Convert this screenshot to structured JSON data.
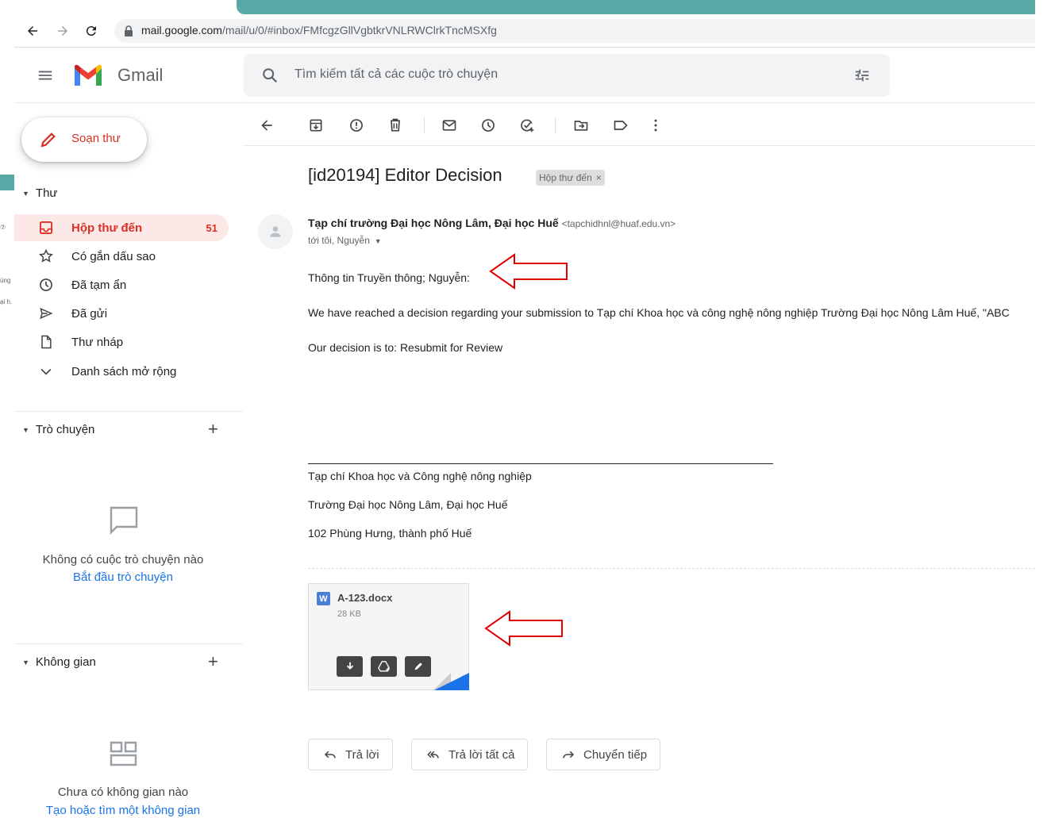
{
  "browser": {
    "url_host": "mail.google.com",
    "url_path": "/mail/u/0/#inbox/FMfcgzGllVgbtkrVNLRWClrkTncMSXfg"
  },
  "header": {
    "brand": "Gmail",
    "search_placeholder": "Tìm kiếm tất cả các cuộc trò chuyện"
  },
  "sidebar": {
    "compose_label": "Soạn thư",
    "mail_section": "Thư",
    "items": [
      {
        "label": "Hộp thư đến",
        "count": "51",
        "icon": "inbox-icon",
        "active": true
      },
      {
        "label": "Có gắn dấu sao",
        "count": "",
        "icon": "star-icon"
      },
      {
        "label": "Đã tạm ẩn",
        "count": "",
        "icon": "clock-icon"
      },
      {
        "label": "Đã gửi",
        "count": "",
        "icon": "send-icon"
      },
      {
        "label": "Thư nháp",
        "count": "",
        "icon": "draft-icon"
      },
      {
        "label": "Danh sách mở rộng",
        "count": "",
        "icon": "chevron-down-icon"
      }
    ],
    "chat": {
      "heading": "Trò chuyện",
      "empty_text": "Không có cuộc trò chuyện nào",
      "empty_link": "Bắt đầu trò chuyện"
    },
    "spaces": {
      "heading": "Không gian",
      "empty_text": "Chưa có không gian nào",
      "empty_link": "Tạo hoặc tìm một không gian"
    },
    "left_sliver": [
      "úng",
      "ại h."
    ]
  },
  "message": {
    "subject": "[id20194] Editor Decision",
    "label": "Hộp thư đến",
    "sender_name": "Tạp chí trường Đại học Nông Lâm, Đại học Huế",
    "sender_email": "<tapchidhnl@huaf.edu.vn>",
    "to_line": "tới tôi, Nguyễn",
    "body": [
      "Thông tin Truyền thông; Nguyễn:",
      "We have reached a decision regarding your submission to Tạp chí Khoa học và công nghệ nông nghiệp Trường Đại học Nông Lâm Huế, \"ABC",
      "Our decision is to: Resubmit for Review"
    ],
    "signature": [
      "Tạp chí Khoa học và Công nghệ nông nghiệp",
      "Trường Đại học Nông Lâm, Đại học Huế",
      "102 Phùng Hưng, thành phố Huế"
    ]
  },
  "attachment": {
    "type_badge": "W",
    "filename": "A-123.docx",
    "size": "28 KB"
  },
  "actions": {
    "reply": "Trả lời",
    "reply_all": "Trả lời tất cả",
    "forward": "Chuyển tiếp"
  },
  "colors": {
    "accent_red": "#d93025",
    "active_bg": "#fce8e6",
    "link_blue": "#1a73e8",
    "annotation_arrow": "#e00000"
  }
}
